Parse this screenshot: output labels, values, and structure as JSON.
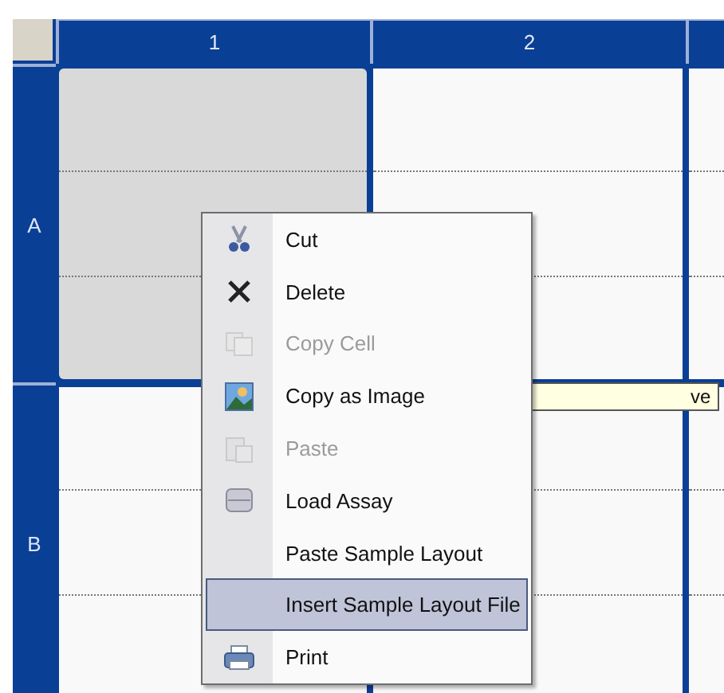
{
  "grid": {
    "columns": [
      "1",
      "2"
    ],
    "rows": [
      {
        "label": "A",
        "cells": [
          {
            "selected": true
          },
          {
            "selected": false
          },
          {
            "selected": false
          }
        ]
      },
      {
        "label": "B",
        "cells": [
          {
            "selected": false
          },
          {
            "selected": false
          },
          {
            "selected": false
          }
        ]
      }
    ]
  },
  "tooltip": {
    "text": "ve"
  },
  "context_menu": {
    "items": [
      {
        "label": "Cut",
        "disabled": false,
        "selected": false
      },
      {
        "label": "Delete",
        "disabled": false,
        "selected": false
      },
      {
        "label": "Copy Cell",
        "disabled": true,
        "selected": false
      },
      {
        "label": "Copy as Image",
        "disabled": false,
        "selected": false
      },
      {
        "label": "Paste",
        "disabled": true,
        "selected": false
      },
      {
        "label": "Load Assay",
        "disabled": false,
        "selected": false
      },
      {
        "label": "Paste Sample Layout",
        "disabled": false,
        "selected": false
      },
      {
        "label": "Insert Sample Layout File",
        "disabled": false,
        "selected": true
      },
      {
        "label": "Print",
        "disabled": false,
        "selected": false
      }
    ]
  }
}
